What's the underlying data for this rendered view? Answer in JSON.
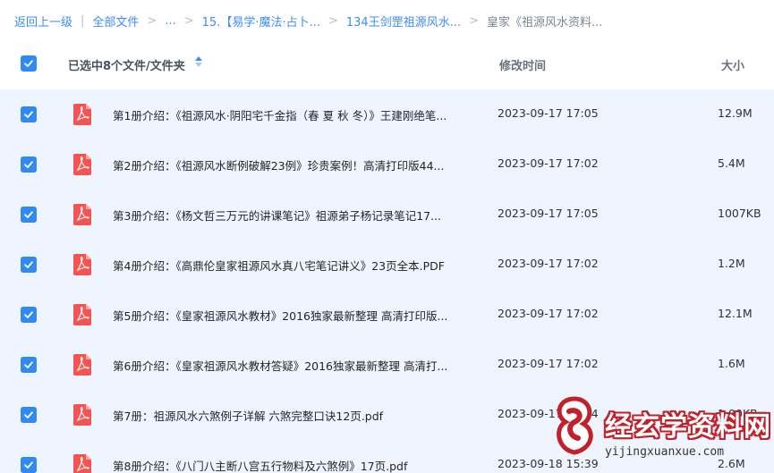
{
  "breadcrumb": {
    "back": "返回上一级",
    "root": "全部文件",
    "ellipsis": "...",
    "level1": "15.【易学·魔法·占卜...",
    "level2": "134王剑罡祖源风水...",
    "current": "皇家《祖源风水资料..."
  },
  "header": {
    "selected_label": "已选中8个文件/文件夹",
    "col_time": "修改时间",
    "col_size": "大小"
  },
  "files": [
    {
      "name": "第1册介绍：《祖源风水·阴阳宅千金指（春 夏 秋 冬）》王建刚绝笔...",
      "time": "2023-09-17 17:05",
      "size": "12.9M"
    },
    {
      "name": "第2册介绍：《祖源风水断例破解23例》珍贵案例！高清打印版44...",
      "time": "2023-09-17 17:02",
      "size": "5.4M"
    },
    {
      "name": "第3册介绍：《杨文哲三万元的讲课笔记》祖源弟子杨记录笔记17...",
      "time": "2023-09-17 17:05",
      "size": "1007KB"
    },
    {
      "name": "第4册介绍：《高鼎伦皇家祖源风水真八宅笔记讲义》23页全本.PDF",
      "time": "2023-09-17 17:02",
      "size": "1.2M"
    },
    {
      "name": "第5册介绍：《皇家祖源风水教材》2016独家最新整理 高清打印版...",
      "time": "2023-09-17 17:02",
      "size": "12.1M"
    },
    {
      "name": "第6册介绍：《皇家祖源风水教材答疑》2016独家最新整理 高清打...",
      "time": "2023-09-17 17:02",
      "size": "1.6M"
    },
    {
      "name": "第7册：祖源风水六煞例子详解 六煞完整口诀12页.pdf",
      "time": "2023-09-17 15:34",
      "size": "1.00KB"
    },
    {
      "name": "第8册介绍：《八门八主断八宫五行物料及六煞例》17页.pdf",
      "time": "2023-09-18 15:39",
      "size": "2.6M"
    }
  ],
  "watermark": {
    "text": "经玄学资料网",
    "url": "yijingxuanxue.com"
  },
  "colors": {
    "accent": "#3189f5",
    "link": "#3b8cff",
    "pdf": "#f25353",
    "list_bg": "#eef5ff"
  }
}
